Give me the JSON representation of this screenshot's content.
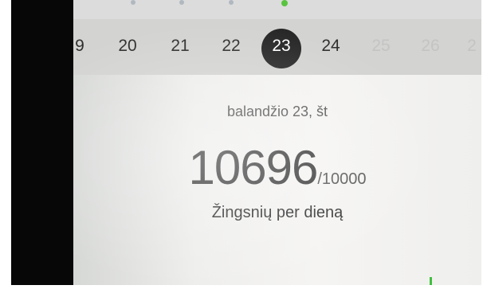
{
  "calendar": {
    "days": [
      {
        "label": "9",
        "faded": false
      },
      {
        "label": "20",
        "faded": false
      },
      {
        "label": "21",
        "faded": false
      },
      {
        "label": "22",
        "faded": false
      },
      {
        "label": "23",
        "faded": false,
        "selected": true
      },
      {
        "label": "24",
        "faded": false
      },
      {
        "label": "25",
        "faded": true
      },
      {
        "label": "26",
        "faded": true
      },
      {
        "label": "2",
        "faded": true
      }
    ]
  },
  "summary": {
    "date": "balandžio 23, št",
    "steps": "10696",
    "goal": "/10000",
    "caption": "Žingsnių per dieną"
  },
  "colors": {
    "accent": "#58c43d",
    "selected_bg": "#272727"
  }
}
